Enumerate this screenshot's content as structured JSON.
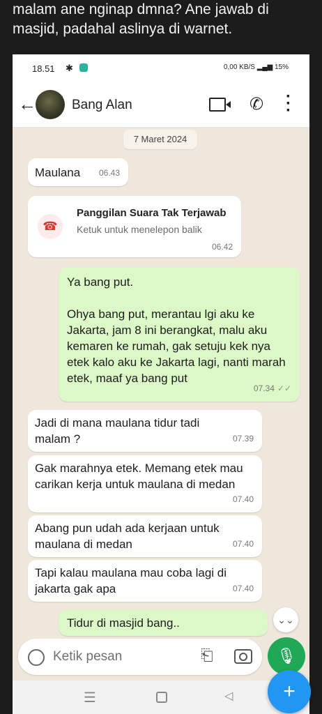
{
  "caption": "malam ane nginap dmna? Ane jawab di masjid, padahal aslinya di warnet.",
  "status": {
    "time": "18.51",
    "net_speed": "0,00 KB/S",
    "battery": "15%"
  },
  "header": {
    "contact_name": "Bang Alan"
  },
  "date_badge": "7 Maret 2024",
  "messages": [
    {
      "dir": "in",
      "text": "Maulana",
      "time": "06.43"
    },
    {
      "dir": "out",
      "text": "Ya bang put.\n\nOhya bang put, merantau lgi aku ke Jakarta, jam 8 ini berangkat, malu aku kemaren ke rumah, gak setuju kek nya etek kalo aku ke Jakarta lagi, nanti marah etek, maaf ya bang put",
      "time": "07.34"
    },
    {
      "dir": "in",
      "text": "Jadi di mana maulana tidur tadi malam ?",
      "time": "07.39"
    },
    {
      "dir": "in",
      "text": "Gak marahnya etek. Memang etek mau carikan kerja untuk maulana di medan",
      "time": "07.40"
    },
    {
      "dir": "in",
      "text": "Abang pun udah ada kerjaan untuk maulana di medan",
      "time": "07.40"
    },
    {
      "dir": "in",
      "text": "Tapi kalau maulana mau coba lagi di jakarta gak apa",
      "time": "07.40"
    },
    {
      "dir": "out",
      "text": "Tidur di masjid bang..",
      "time": ""
    }
  ],
  "missed_call": {
    "title": "Panggilan Suara Tak Terjawab",
    "subtitle": "Ketuk untuk menelepon balik",
    "time": "06.42"
  },
  "input": {
    "placeholder": "Ketik pesan"
  },
  "icons": {
    "back": "arrow-left-icon",
    "video": "video-call-icon",
    "call": "phone-icon",
    "menu": "more-vertical-icon",
    "missed": "missed-call-icon",
    "emoji": "emoji-icon",
    "attach": "paperclip-icon",
    "camera": "camera-icon",
    "mic": "microphone-icon",
    "fab": "plus-icon"
  }
}
